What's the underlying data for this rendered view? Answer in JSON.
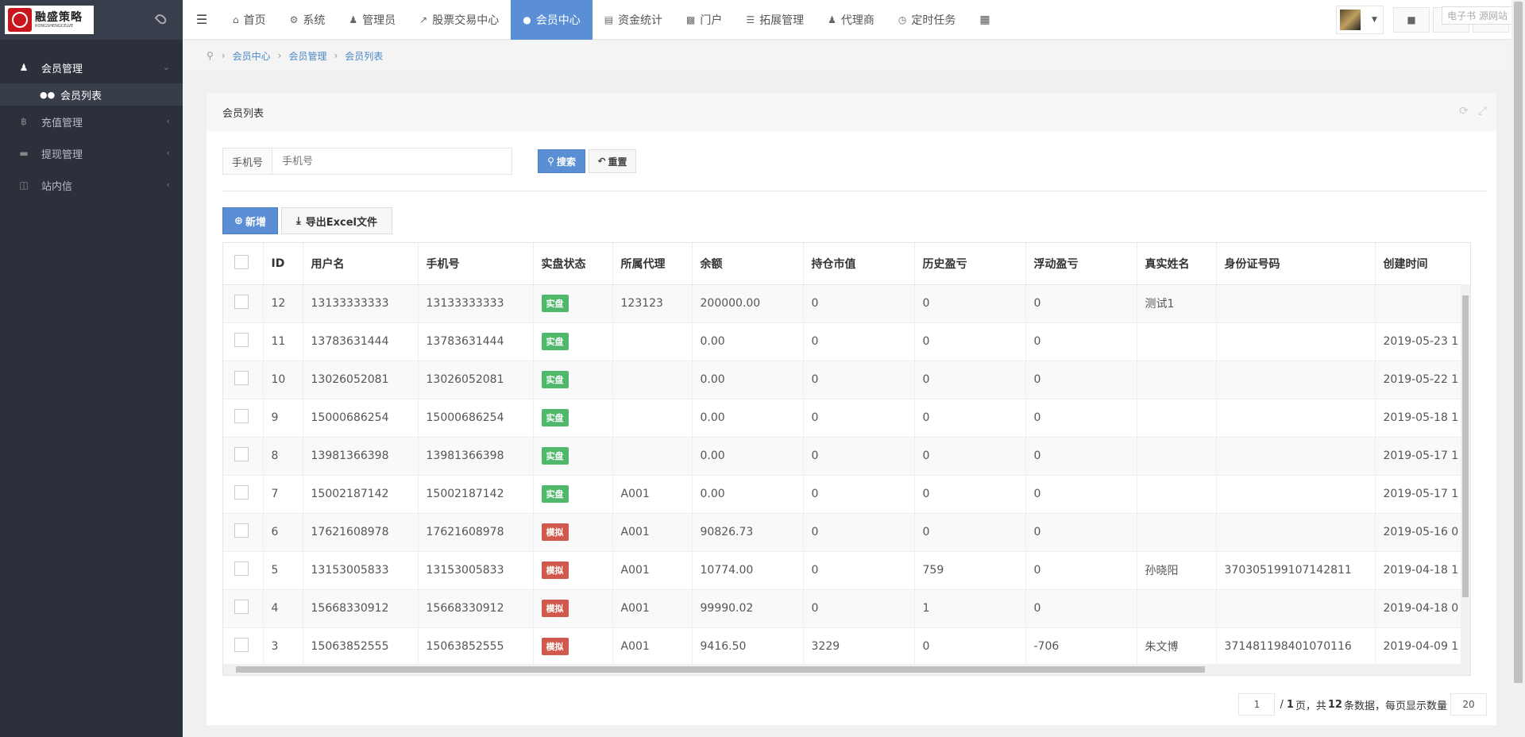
{
  "logo": {
    "name_cn": "融盛策略",
    "name_en": "RONGSHENGCELVE"
  },
  "sidebar": {
    "items": [
      {
        "label": "会员管理",
        "icon": "person-icon",
        "open": true,
        "children": [
          {
            "label": "会员列表",
            "icon": "users-icon"
          }
        ]
      },
      {
        "label": "充值管理",
        "icon": "bitcoin-icon"
      },
      {
        "label": "提现管理",
        "icon": "card-icon"
      },
      {
        "label": "站内信",
        "icon": "folder-icon"
      }
    ]
  },
  "topnav": {
    "tabs": [
      {
        "label": "首页",
        "icon": "home-icon"
      },
      {
        "label": "系统",
        "icon": "gear-icon"
      },
      {
        "label": "管理员",
        "icon": "user-icon"
      },
      {
        "label": "股票交易中心",
        "icon": "line-chart-icon"
      },
      {
        "label": "会员中心",
        "icon": "users-icon",
        "active": true
      },
      {
        "label": "资金统计",
        "icon": "bar-chart-icon"
      },
      {
        "label": "门户",
        "icon": "newspaper-icon"
      },
      {
        "label": "拓展管理",
        "icon": "list-icon"
      },
      {
        "label": "代理商",
        "icon": "male-icon"
      },
      {
        "label": "定时任务",
        "icon": "clock-icon"
      }
    ],
    "right": {
      "doc_button": "电子书",
      "tooltip": "电子书 源网站"
    }
  },
  "breadcrumb": [
    "会员中心",
    "会员管理",
    "会员列表"
  ],
  "panel": {
    "title": "会员列表"
  },
  "search": {
    "label": "手机号",
    "placeholder": "手机号",
    "search_button": "搜索",
    "reset_button": "重置"
  },
  "actions": {
    "add_button": "新增",
    "export_button": "导出Excel文件"
  },
  "table": {
    "columns": [
      "ID",
      "用户名",
      "手机号",
      "实盘状态",
      "所属代理",
      "余额",
      "持仓市值",
      "历史盈亏",
      "浮动盈亏",
      "真实姓名",
      "身份证号码",
      "创建时间"
    ],
    "rows": [
      {
        "id": "12",
        "username": "13133333333",
        "phone": "13133333333",
        "status": "实盘",
        "agent": "123123",
        "balance": "200000.00",
        "position": "0",
        "hist": "0",
        "float": "0",
        "name": "测试1",
        "idcard": "",
        "created": ""
      },
      {
        "id": "11",
        "username": "13783631444",
        "phone": "13783631444",
        "status": "实盘",
        "agent": "",
        "balance": "0.00",
        "position": "0",
        "hist": "0",
        "float": "0",
        "name": "",
        "idcard": "",
        "created": "2019-05-23 1"
      },
      {
        "id": "10",
        "username": "13026052081",
        "phone": "13026052081",
        "status": "实盘",
        "agent": "",
        "balance": "0.00",
        "position": "0",
        "hist": "0",
        "float": "0",
        "name": "",
        "idcard": "",
        "created": "2019-05-22 1"
      },
      {
        "id": "9",
        "username": "15000686254",
        "phone": "15000686254",
        "status": "实盘",
        "agent": "",
        "balance": "0.00",
        "position": "0",
        "hist": "0",
        "float": "0",
        "name": "",
        "idcard": "",
        "created": "2019-05-18 1"
      },
      {
        "id": "8",
        "username": "13981366398",
        "phone": "13981366398",
        "status": "实盘",
        "agent": "",
        "balance": "0.00",
        "position": "0",
        "hist": "0",
        "float": "0",
        "name": "",
        "idcard": "",
        "created": "2019-05-17 1"
      },
      {
        "id": "7",
        "username": "15002187142",
        "phone": "15002187142",
        "status": "实盘",
        "agent": "A001",
        "balance": "0.00",
        "position": "0",
        "hist": "0",
        "float": "0",
        "name": "",
        "idcard": "",
        "created": "2019-05-17 1"
      },
      {
        "id": "6",
        "username": "17621608978",
        "phone": "17621608978",
        "status": "模拟",
        "agent": "A001",
        "balance": "90826.73",
        "position": "0",
        "hist": "0",
        "float": "0",
        "name": "",
        "idcard": "",
        "created": "2019-05-16 0"
      },
      {
        "id": "5",
        "username": "13153005833",
        "phone": "13153005833",
        "status": "模拟",
        "agent": "A001",
        "balance": "10774.00",
        "position": "0",
        "hist": "759",
        "float": "0",
        "name": "孙晓阳",
        "idcard": "370305199107142811",
        "created": "2019-04-18 1"
      },
      {
        "id": "4",
        "username": "15668330912",
        "phone": "15668330912",
        "status": "模拟",
        "agent": "A001",
        "balance": "99990.02",
        "position": "0",
        "hist": "1",
        "float": "0",
        "name": "",
        "idcard": "",
        "created": "2019-04-18 0"
      },
      {
        "id": "3",
        "username": "15063852555",
        "phone": "15063852555",
        "status": "模拟",
        "agent": "A001",
        "balance": "9416.50",
        "position": "3229",
        "hist": "0",
        "float": "-706",
        "name": "朱文博",
        "idcard": "371481198401070116",
        "created": "2019-04-09 1"
      }
    ]
  },
  "pager": {
    "current": "1",
    "total_pages": "1",
    "total_rows": "12",
    "page_size": "20",
    "t_page": "页，共",
    "t_rows": "条数据，每页显示数量",
    "slash": "/"
  },
  "colors": {
    "sidebar": "#2b303b",
    "accent": "#5a8fd6",
    "real": "#4fb86b",
    "sim": "#d0584c"
  }
}
